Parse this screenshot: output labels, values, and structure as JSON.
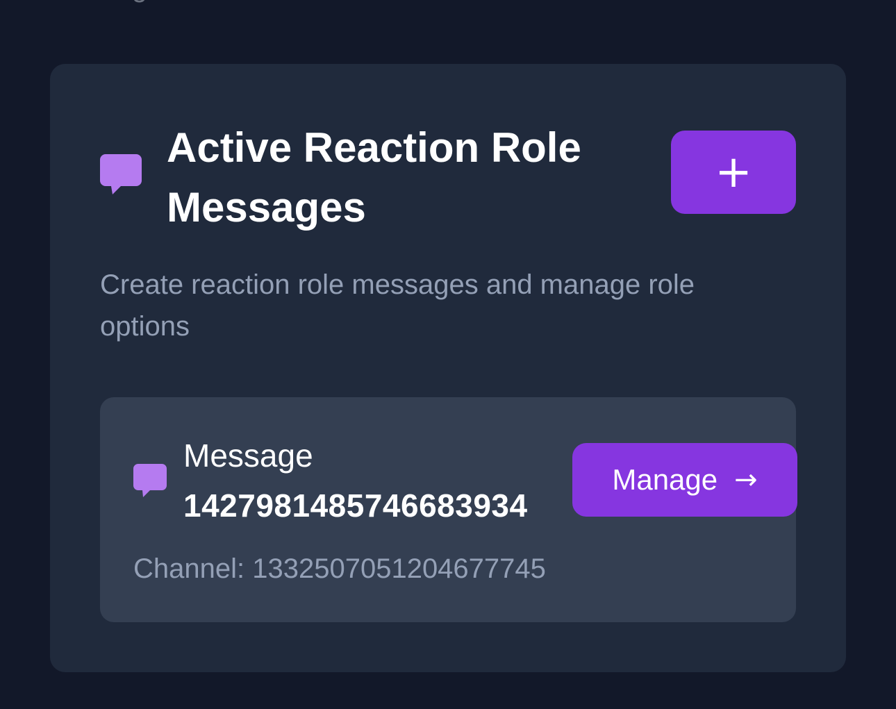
{
  "header": {
    "clipped_text": "messages"
  },
  "section": {
    "icon": "chat-bubble-icon",
    "title_line1": "Active Reaction Role",
    "title_line2": "Messages",
    "add_label": "+",
    "add_icon": "plus-icon",
    "description": "Create reaction role messages and manage role options"
  },
  "messages": [
    {
      "icon": "chat-bubble-icon",
      "label": "Message",
      "id": "1427981485746683934",
      "manage_label": "Manage",
      "manage_arrow": "→",
      "channel_text": "Channel: 1332507051204677745"
    }
  ],
  "colors": {
    "background": "#121829",
    "card": "#202a3c",
    "inner_card": "#343f52",
    "accent": "#8636e0",
    "icon": "#b57bf0",
    "muted_text": "#94a0b6"
  }
}
